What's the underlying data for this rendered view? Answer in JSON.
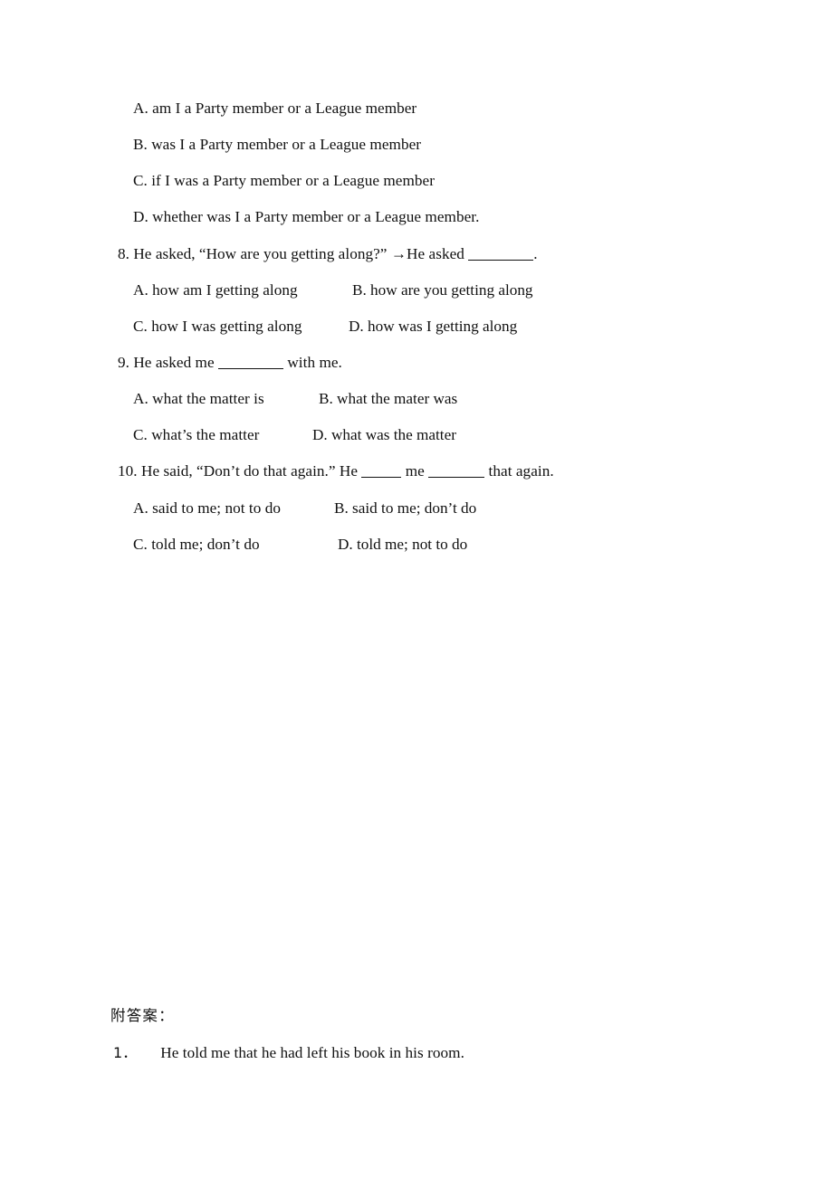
{
  "document": {
    "page_background": "#ffffff",
    "text_color": "#111111"
  },
  "carryover_options": {
    "a": "A. am I a Party member or a League member",
    "b": "B. was I a Party member or a League member",
    "c": "C. if I was a Party member or a League member",
    "d": "D. whether was I a Party member or a League member."
  },
  "questions": [
    {
      "number": "8.",
      "stem_before_blank": "8. He asked, “How are you getting along?” →He asked ",
      "stem_after_blank": ".",
      "options": {
        "a": "A. how am I getting along",
        "b": "B. how are you getting along",
        "c": "C. how I was getting along",
        "d": "D. how was I getting along"
      }
    },
    {
      "number": "9.",
      "stem_before_blank": "9. He asked me ",
      "stem_after_blank": " with me.",
      "options": {
        "a": "A. what the matter is",
        "b": "B. what the mater was",
        "c": "C. what’s the matter",
        "d": "D. what was the matter"
      }
    },
    {
      "number": "10.",
      "stem_part1": "10. He said, “Don’t do that again.” He ",
      "stem_part2": " me ",
      "stem_part3": " that again.",
      "options": {
        "a": "A. said to me; not to do",
        "b": "B. said to me; don’t do",
        "c": "C. told me; don’t do",
        "d": "D. told me; not to do"
      }
    }
  ],
  "answer_section": {
    "heading": "附答案：",
    "items": [
      {
        "number": "1．",
        "text": "He told me that he had left his book in his room."
      }
    ]
  }
}
